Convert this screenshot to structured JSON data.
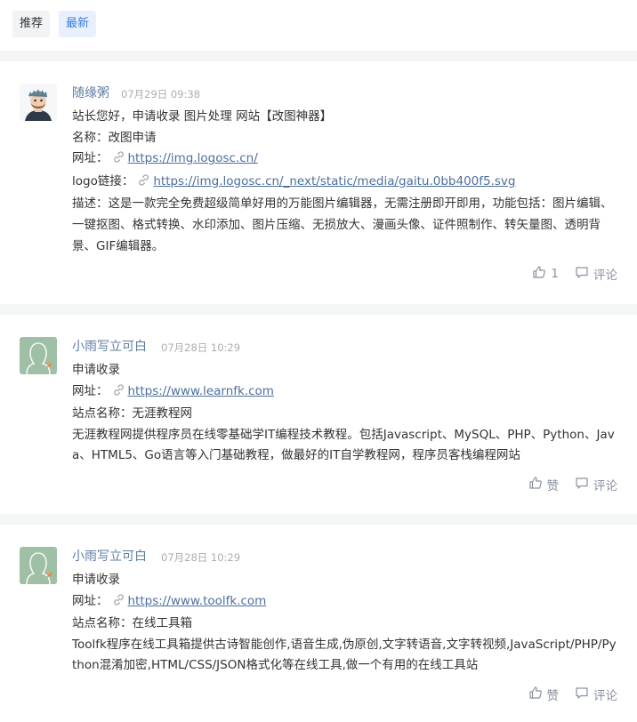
{
  "tabs": {
    "recommend": "推荐",
    "latest": "最新"
  },
  "posts": [
    {
      "author": "随缘粥",
      "time": "07月29日 09:38",
      "lines": [
        "站长您好，申请收录 图片处理 网站【改图神器】",
        "名称：改图申请"
      ],
      "url_label": "网址：",
      "url": "https://img.logosc.cn/",
      "logo_label": "logo链接：",
      "logo_url": "https://img.logosc.cn/_next/static/media/gaitu.0bb400f5.svg",
      "description": "描述：这是一款完全免费超级简单好用的万能图片编辑器，无需注册即开即用，功能包括：图片编辑、一键抠图、格式转换、水印添加、图片压缩、无损放大、漫画头像、证件照制作、转矢量图、透明背景、GIF编辑器。",
      "like_count": "1",
      "comment_label": "评论"
    },
    {
      "author": "小雨写立可白",
      "time": "07月28日 10:29",
      "line1": "申请收录",
      "url_label": "网址：",
      "url": "https://www.learnfk.com",
      "site_name": "站点名称：无涯教程网",
      "description": "无涯教程网提供程序员在线零基础学IT编程技术教程。包括Javascript、MySQL、PHP、Python、Java、HTML5、Go语言等入门基础教程，做最好的IT自学教程网，程序员客栈编程网站",
      "like_label": "赞",
      "comment_label": "评论"
    },
    {
      "author": "小雨写立可白",
      "time": "07月28日 10:29",
      "line1": "申请收录",
      "url_label": "网址：",
      "url": "https://www.toolfk.com",
      "site_name": "站点名称：在线工具箱",
      "description": "Toolfk程序在线工具箱提供古诗智能创作,语音生成,伪原创,文字转语音,文字转视频,JavaScript/PHP/Python混淆加密,HTML/CSS/JSON格式化等在线工具,做一个有用的在线工具站",
      "like_label": "赞",
      "comment_label": "评论"
    }
  ],
  "icons": {
    "like": "thumbs-up-icon",
    "comment": "comment-icon",
    "link": "link-icon"
  },
  "colors": {
    "author": "#5d7ca3",
    "link": "#4d6f9e",
    "active_tab_bg": "#e8f0fe",
    "active_tab_text": "#3b7bdc",
    "meta": "#a9adb3",
    "action": "#8a919f"
  }
}
